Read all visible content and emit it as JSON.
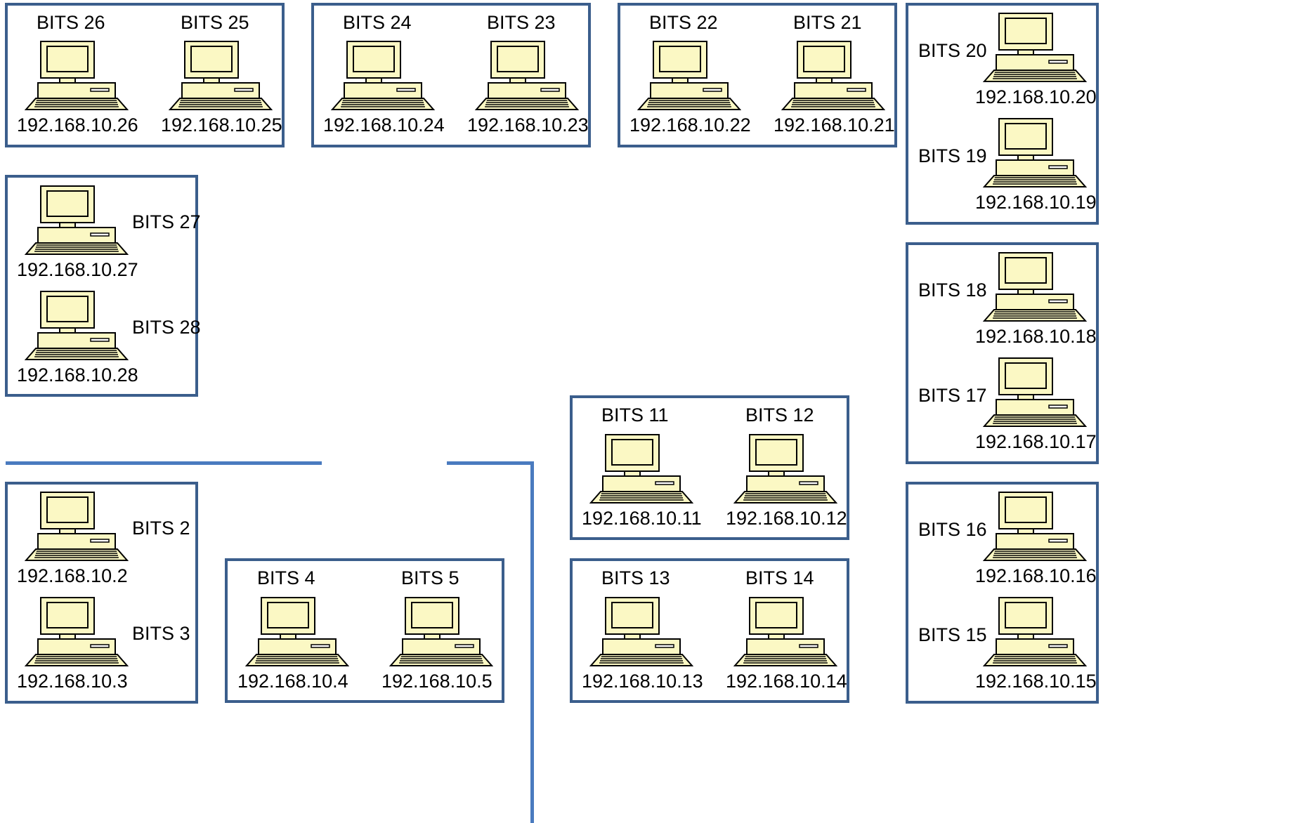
{
  "groups": [
    {
      "id": "g-26-25",
      "hosts": [
        {
          "name": "BITS 26",
          "ip": "192.168.10.26"
        },
        {
          "name": "BITS 25",
          "ip": "192.168.10.25"
        }
      ]
    },
    {
      "id": "g-24-23",
      "hosts": [
        {
          "name": "BITS 24",
          "ip": "192.168.10.24"
        },
        {
          "name": "BITS 23",
          "ip": "192.168.10.23"
        }
      ]
    },
    {
      "id": "g-22-21",
      "hosts": [
        {
          "name": "BITS 22",
          "ip": "192.168.10.22"
        },
        {
          "name": "BITS 21",
          "ip": "192.168.10.21"
        }
      ]
    },
    {
      "id": "g-20-19",
      "hosts": [
        {
          "name": "BITS 20",
          "ip": "192.168.10.20"
        },
        {
          "name": "BITS 19",
          "ip": "192.168.10.19"
        }
      ]
    },
    {
      "id": "g-27-28",
      "hosts": [
        {
          "name": "BITS 27",
          "ip": "192.168.10.27"
        },
        {
          "name": "BITS 28",
          "ip": "192.168.10.28"
        }
      ]
    },
    {
      "id": "g-18-17",
      "hosts": [
        {
          "name": "BITS 18",
          "ip": "192.168.10.18"
        },
        {
          "name": "BITS 17",
          "ip": "192.168.10.17"
        }
      ]
    },
    {
      "id": "g-11-12",
      "hosts": [
        {
          "name": "BITS 11",
          "ip": "192.168.10.11"
        },
        {
          "name": "BITS 12",
          "ip": "192.168.10.12"
        }
      ]
    },
    {
      "id": "g-2-3",
      "hosts": [
        {
          "name": "BITS 2",
          "ip": "192.168.10.2"
        },
        {
          "name": "BITS 3",
          "ip": "192.168.10.3"
        }
      ]
    },
    {
      "id": "g-4-5",
      "hosts": [
        {
          "name": "BITS 4",
          "ip": "192.168.10.4"
        },
        {
          "name": "BITS 5",
          "ip": "192.168.10.5"
        }
      ]
    },
    {
      "id": "g-13-14",
      "hosts": [
        {
          "name": "BITS 13",
          "ip": "192.168.10.13"
        },
        {
          "name": "BITS 14",
          "ip": "192.168.10.14"
        }
      ]
    },
    {
      "id": "g-16-15",
      "hosts": [
        {
          "name": "BITS 16",
          "ip": "192.168.10.16"
        },
        {
          "name": "BITS 15",
          "ip": "192.168.10.15"
        }
      ]
    }
  ],
  "colors": {
    "group_border": "#3b5e8c",
    "wall": "#4a7bbf",
    "computer_fill": "#fbf8c4",
    "computer_stroke": "#000000"
  },
  "icons": {
    "host": "desktop-computer-icon"
  }
}
